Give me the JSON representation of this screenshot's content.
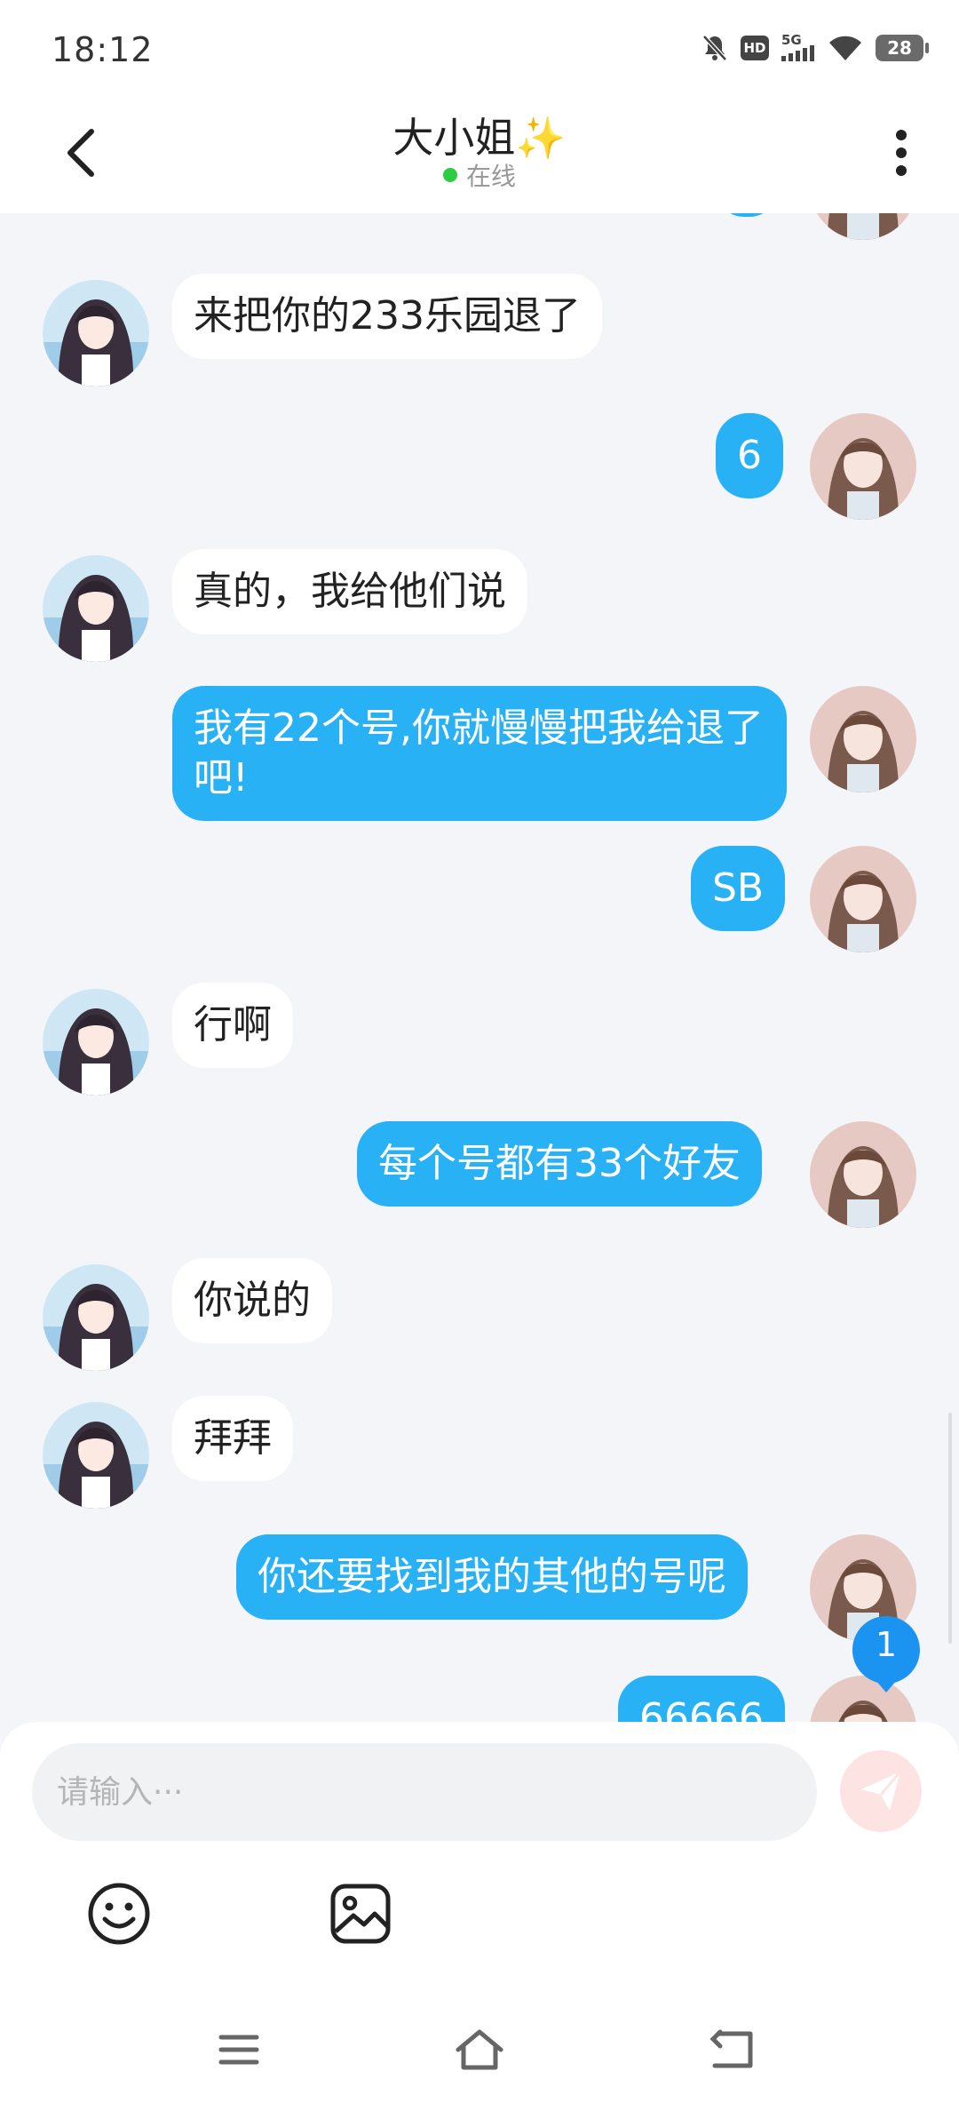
{
  "status_bar": {
    "time": "18:12",
    "icons": [
      "bell-muted-icon",
      "hd-icon",
      "signal-5g-icon",
      "wifi-icon",
      "battery-icon"
    ],
    "hd_label": "HD",
    "network_label": "5G",
    "battery_level": "28"
  },
  "header": {
    "title": "大小姐✨",
    "status": "在线",
    "status_color": "#2ecc40"
  },
  "messages": [
    {
      "side": "in",
      "text": "来把你的233乐园退了"
    },
    {
      "side": "out",
      "text": "6"
    },
    {
      "side": "in",
      "text": "真的，我给他们说"
    },
    {
      "side": "out",
      "text": "我有22个号,你就慢慢把我给退了吧!"
    },
    {
      "side": "out",
      "text": "SB"
    },
    {
      "side": "in",
      "text": "行啊"
    },
    {
      "side": "out",
      "text": "每个号都有33个好友"
    },
    {
      "side": "in",
      "text": "你说的"
    },
    {
      "side": "in",
      "text": "拜拜"
    },
    {
      "side": "out",
      "text": "你还要找到我的其他的号呢"
    },
    {
      "side": "out",
      "text": "66666"
    }
  ],
  "unread_badge": "1",
  "input": {
    "placeholder": "请输入···",
    "value": ""
  },
  "colors": {
    "outgoing_bubble": "#29b1f5",
    "incoming_bubble": "#ffffff",
    "send_button": "#fde3e1",
    "badge": "#1a94f0"
  }
}
